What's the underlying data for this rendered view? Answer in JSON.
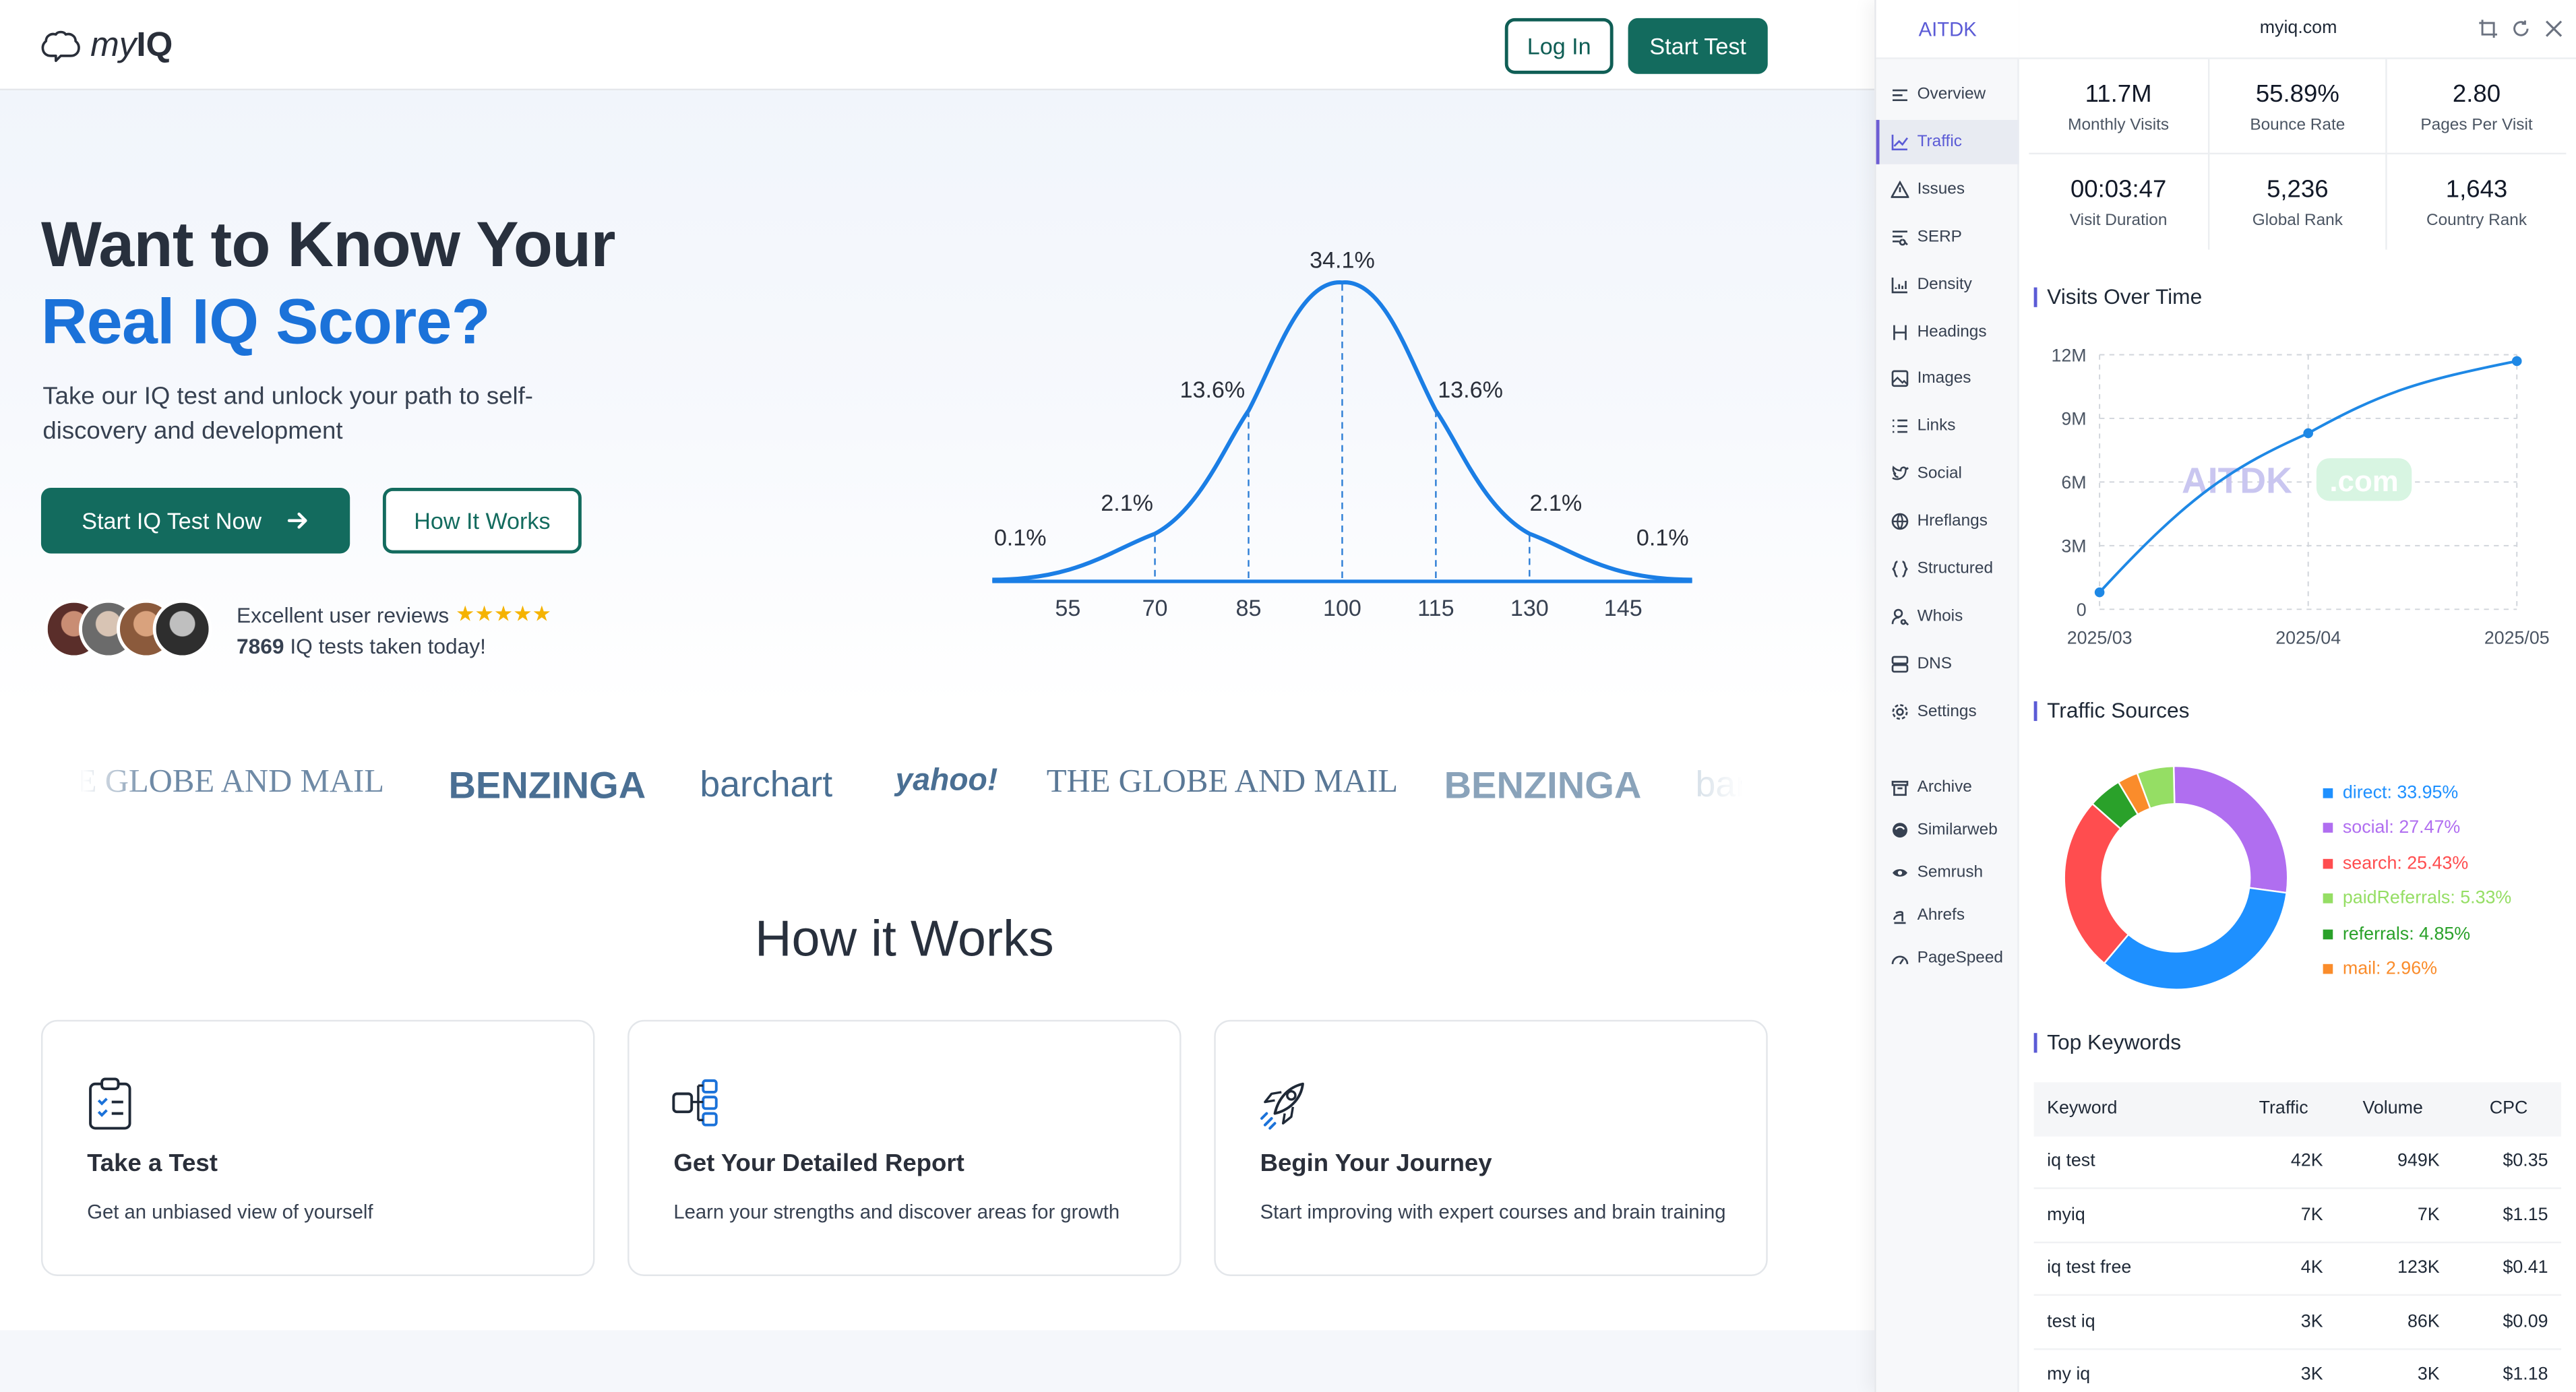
{
  "site": {
    "logo_text_light": "my",
    "logo_text_bold": "IQ",
    "login_label": "Log In",
    "start_label": "Start Test"
  },
  "hero": {
    "title_line1": "Want to Know Your",
    "title_line2": "Real IQ Score?",
    "subtitle": "Take our IQ test and unlock your path to self-discovery and development",
    "primary_button": "Start IQ Test Now",
    "secondary_button": "How It Works",
    "reviews_text": "Excellent user reviews",
    "stars": "★★★★★",
    "tests_count": "7869",
    "tests_text": "IQ tests taken today!"
  },
  "bell_curve": {
    "percent_labels": [
      "0.1%",
      "2.1%",
      "13.6%",
      "34.1%",
      "13.6%",
      "2.1%",
      "0.1%"
    ],
    "x_ticks": [
      "55",
      "70",
      "85",
      "100",
      "115",
      "130",
      "145"
    ]
  },
  "press_logos": [
    "THE GLOBE AND MAIL",
    "BENZINGA",
    "barchart",
    "yahoo!",
    "THE GLOBE AND MAIL",
    "BENZINGA",
    "barchart"
  ],
  "how": {
    "title": "How it Works",
    "cards": [
      {
        "title": "Take a Test",
        "text": "Get an unbiased view of yourself",
        "icon": "clipboard-icon"
      },
      {
        "title": "Get Your Detailed Report",
        "text": "Learn your strengths and discover areas for growth",
        "icon": "flowchart-icon"
      },
      {
        "title": "Begin Your Journey",
        "text": "Start improving with expert courses and brain training",
        "icon": "rocket-icon"
      }
    ]
  },
  "ext": {
    "brand": "AITDK",
    "domain": "myiq.com",
    "nav": [
      {
        "label": "Overview",
        "icon": "overview-icon"
      },
      {
        "label": "Traffic",
        "icon": "traffic-icon",
        "active": true
      },
      {
        "label": "Issues",
        "icon": "warning-icon"
      },
      {
        "label": "SERP",
        "icon": "serp-icon"
      },
      {
        "label": "Density",
        "icon": "density-icon"
      },
      {
        "label": "Headings",
        "icon": "heading-icon"
      },
      {
        "label": "Images",
        "icon": "image-icon"
      },
      {
        "label": "Links",
        "icon": "links-icon"
      },
      {
        "label": "Social",
        "icon": "twitter-icon"
      },
      {
        "label": "Hreflangs",
        "icon": "globe-icon"
      },
      {
        "label": "Structured",
        "icon": "braces-icon"
      },
      {
        "label": "Whois",
        "icon": "user-search-icon"
      },
      {
        "label": "DNS",
        "icon": "server-icon"
      },
      {
        "label": "Settings",
        "icon": "gear-icon"
      }
    ],
    "tools": [
      {
        "label": "Archive",
        "icon": "archive-icon"
      },
      {
        "label": "Similarweb",
        "icon": "similarweb-icon"
      },
      {
        "label": "Semrush",
        "icon": "semrush-icon"
      },
      {
        "label": "Ahrefs",
        "icon": "ahrefs-icon"
      },
      {
        "label": "PageSpeed",
        "icon": "pagespeed-icon"
      }
    ],
    "stats": [
      {
        "value": "11.7M",
        "label": "Monthly Visits"
      },
      {
        "value": "55.89%",
        "label": "Bounce Rate"
      },
      {
        "value": "2.80",
        "label": "Pages Per Visit"
      },
      {
        "value": "00:03:47",
        "label": "Visit Duration"
      },
      {
        "value": "5,236",
        "label": "Global Rank"
      },
      {
        "value": "1,643",
        "label": "Country Rank"
      }
    ],
    "visits_title": "Visits Over Time",
    "sources_title": "Traffic Sources",
    "keywords_title": "Top Keywords",
    "watermark": "AITDK",
    "watermark_suffix": ".com",
    "keyword_headers": {
      "keyword": "Keyword",
      "traffic": "Traffic",
      "volume": "Volume",
      "cpc": "CPC"
    },
    "keywords": [
      {
        "keyword": "iq test",
        "traffic": "42K",
        "volume": "949K",
        "cpc": "$0.35"
      },
      {
        "keyword": "myiq",
        "traffic": "7K",
        "volume": "7K",
        "cpc": "$1.15"
      },
      {
        "keyword": "iq test free",
        "traffic": "4K",
        "volume": "123K",
        "cpc": "$0.41"
      },
      {
        "keyword": "test iq",
        "traffic": "3K",
        "volume": "86K",
        "cpc": "$0.09"
      },
      {
        "keyword": "my iq",
        "traffic": "3K",
        "volume": "3K",
        "cpc": "$1.18"
      }
    ],
    "colors": {
      "accent": "#5b5bd6",
      "brand_green": "#136b5e",
      "hero_blue": "#1b72d9"
    }
  },
  "chart_data": [
    {
      "type": "line",
      "x": [
        "2025/03",
        "2025/04",
        "2025/05"
      ],
      "y_ticks": [
        "0",
        "3M",
        "6M",
        "9M",
        "12M"
      ],
      "ylim": [
        0,
        12000000
      ],
      "series": [
        {
          "values": [
            800000,
            8300000,
            11700000
          ]
        }
      ],
      "grid": true
    },
    {
      "type": "pie",
      "series": [
        {
          "name": "direct",
          "label": "direct: 33.95%",
          "value": 33.95,
          "color": "#1e90ff"
        },
        {
          "name": "social",
          "label": "social: 27.47%",
          "value": 27.47,
          "color": "#b06ef0"
        },
        {
          "name": "search",
          "label": "search: 25.43%",
          "value": 25.43,
          "color": "#ff4d4f"
        },
        {
          "name": "paidReferrals",
          "label": "paidReferrals: 5.33%",
          "value": 5.33,
          "color": "#95de64"
        },
        {
          "name": "referrals",
          "label": "referrals: 4.85%",
          "value": 4.85,
          "color": "#2aa12a"
        },
        {
          "name": "mail",
          "label": "mail: 2.96%",
          "value": 2.96,
          "color": "#fa8c2b"
        }
      ]
    }
  ]
}
